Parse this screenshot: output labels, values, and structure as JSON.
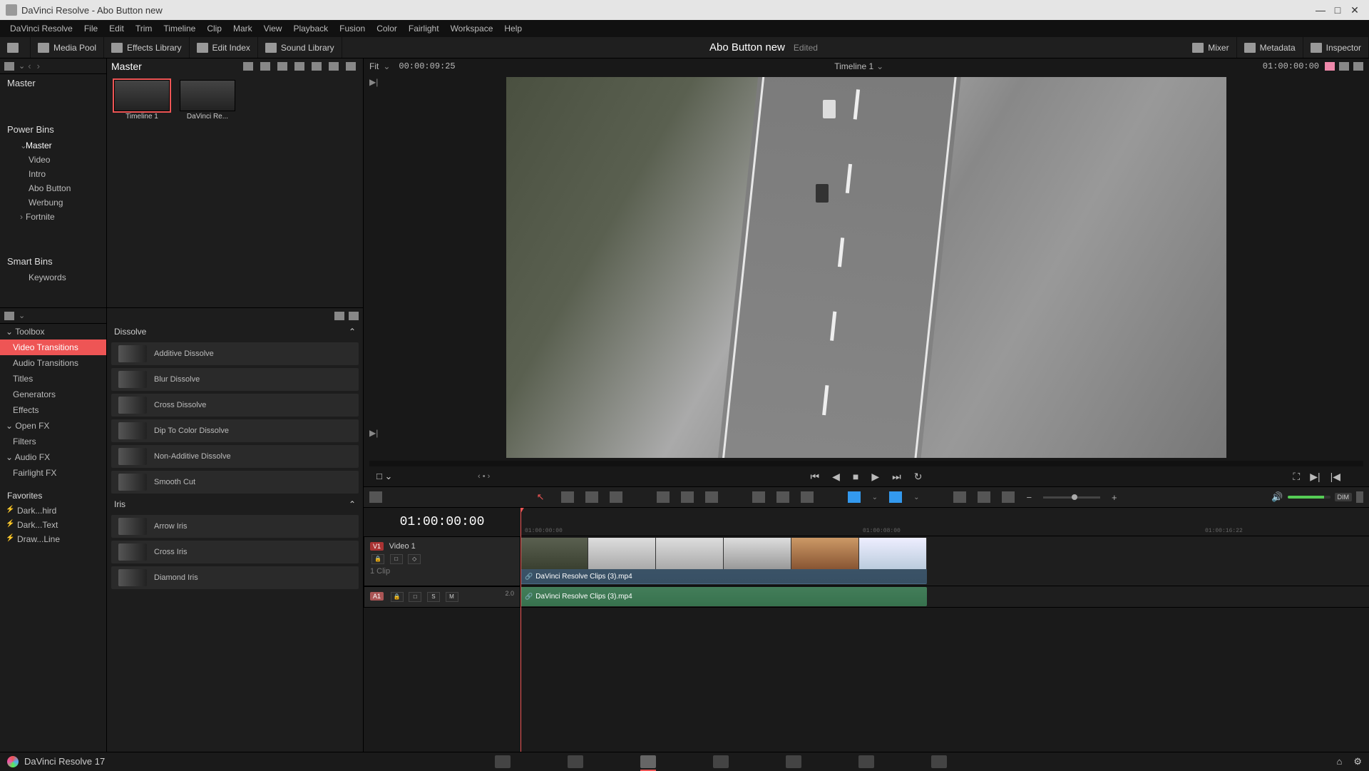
{
  "titlebar": {
    "text": "DaVinci Resolve - Abo Button new"
  },
  "menus": [
    "DaVinci Resolve",
    "File",
    "Edit",
    "Trim",
    "Timeline",
    "Clip",
    "Mark",
    "View",
    "Playback",
    "Fusion",
    "Color",
    "Fairlight",
    "Workspace",
    "Help"
  ],
  "topToolbar": {
    "mediaPool": "Media Pool",
    "effectsLibrary": "Effects Library",
    "editIndex": "Edit Index",
    "soundLibrary": "Sound Library",
    "projectName": "Abo Button new",
    "edited": "Edited",
    "mixer": "Mixer",
    "metadata": "Metadata",
    "inspector": "Inspector"
  },
  "binRoot": "Master",
  "binTabs": {
    "master": "Master"
  },
  "powerBinsLabel": "Power Bins",
  "powerBins": [
    {
      "label": "Master",
      "children": [
        "Video",
        "Intro",
        "Abo Button",
        "Werbung"
      ]
    },
    {
      "label": "Fortnite",
      "children": []
    }
  ],
  "smartBinsLabel": "Smart Bins",
  "smartBins": [
    "Keywords"
  ],
  "mediaItems": [
    {
      "label": "Timeline 1",
      "sel": true
    },
    {
      "label": "DaVinci Re..."
    }
  ],
  "toolbox": {
    "header": "Toolbox",
    "items": [
      "Video Transitions",
      "Audio Transitions",
      "Titles",
      "Generators",
      "Effects"
    ],
    "openfx": "Open FX",
    "filters": "Filters",
    "audiofx": "Audio FX",
    "fairlightfx": "Fairlight FX",
    "favorites": "Favorites",
    "favItems": [
      "Dark...hird",
      "Dark...Text",
      "Draw...Line"
    ]
  },
  "fx": {
    "cat1": "Dissolve",
    "list1": [
      "Additive Dissolve",
      "Blur Dissolve",
      "Cross Dissolve",
      "Dip To Color Dissolve",
      "Non-Additive Dissolve",
      "Smooth Cut"
    ],
    "cat2": "Iris",
    "list2": [
      "Arrow Iris",
      "Cross Iris",
      "Diamond Iris"
    ]
  },
  "viewer": {
    "fit": "Fit",
    "tc": "00:00:09:25",
    "timelineName": "Timeline 1",
    "recordTC": "01:00:00:00"
  },
  "timeline": {
    "tc": "01:00:00:00",
    "ticks": [
      "01:00:00:00",
      "01:00:08:00",
      "01:00:16:22"
    ],
    "video1": {
      "tag": "V1",
      "name": "Video 1",
      "clips": "1 Clip"
    },
    "audio1": {
      "tag": "A1",
      "mute": "M",
      "solo": "S",
      "lock": "□",
      "rec": "□",
      "vol": "2.0"
    },
    "clipName": "DaVinci Resolve Clips (3).mp4",
    "dim": "DIM"
  },
  "app": {
    "name": "DaVinci Resolve 17"
  }
}
